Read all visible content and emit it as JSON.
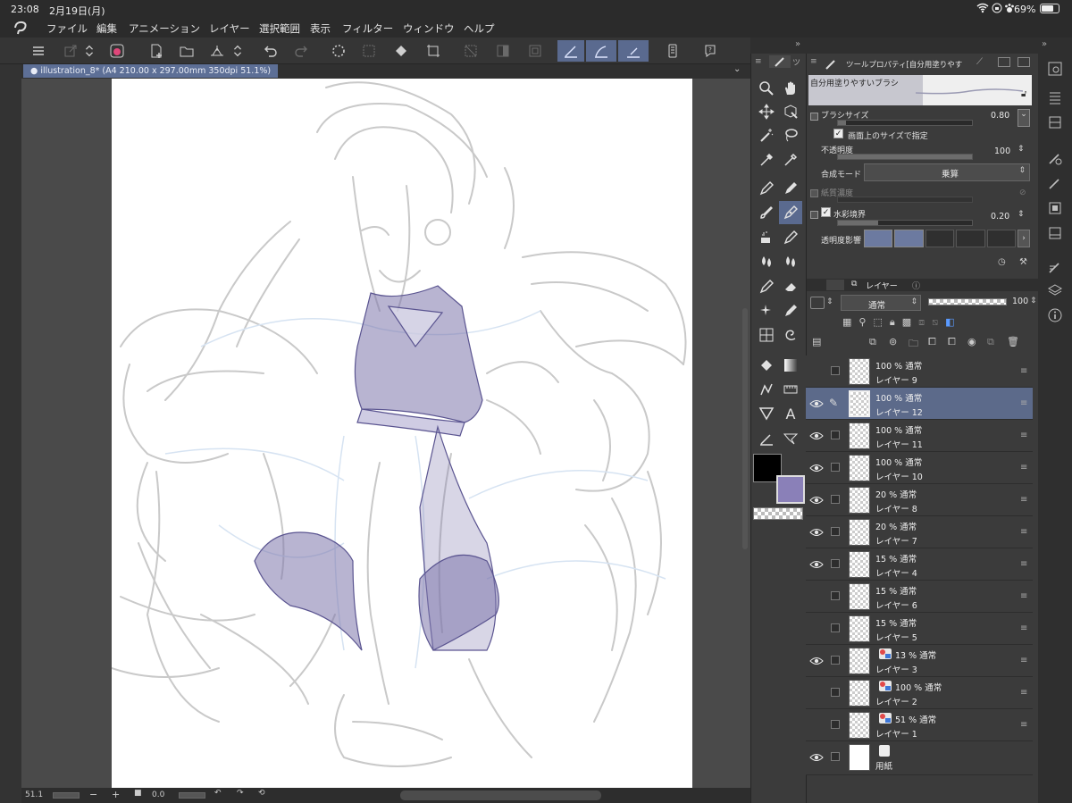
{
  "status": {
    "time": "23:08",
    "date": "2月19日(月)",
    "battery": "69%"
  },
  "menu": [
    "ファイル",
    "編集",
    "アニメーション",
    "レイヤー",
    "選択範囲",
    "表示",
    "フィルター",
    "ウィンドウ",
    "ヘルプ"
  ],
  "canvas": {
    "tab_label": "illustration_8* (A4 210.00 x 297.00mm 350dpi 51.1%)"
  },
  "bottom": {
    "zoom": "51.1",
    "angle": "0.0"
  },
  "tool_property": {
    "header": "ツールプロパティ[自分用塗りやす",
    "header_tab2": "ツ",
    "brush_name": "自分用塗りやすいブラシ",
    "brush_size_label": "ブラシサイズ",
    "brush_size_value": "0.80",
    "screen_size_label": "画面上のサイズで指定",
    "opacity_label": "不透明度",
    "opacity_value": "100",
    "blend_label": "合成モード",
    "blend_value": "乗算",
    "paper_label": "紙質濃度",
    "watercolor_label": "水彩境界",
    "watercolor_value": "0.20",
    "trans_label": "透明度影響"
  },
  "layer_panel": {
    "tab": "レイヤー",
    "blend_mode": "通常",
    "opacity": "100",
    "layers": [
      {
        "pct": "100 %  通常",
        "name": "レイヤー 9",
        "visible": false,
        "selected": false,
        "kind": "raster"
      },
      {
        "pct": "100 %  通常",
        "name": "レイヤー 12",
        "visible": true,
        "selected": true,
        "kind": "raster"
      },
      {
        "pct": "100 %  通常",
        "name": "レイヤー 11",
        "visible": true,
        "selected": false,
        "kind": "raster"
      },
      {
        "pct": "100 %  通常",
        "name": "レイヤー 10",
        "visible": true,
        "selected": false,
        "kind": "raster"
      },
      {
        "pct": "20 %  通常",
        "name": "レイヤー 8",
        "visible": true,
        "selected": false,
        "kind": "raster"
      },
      {
        "pct": "20 %  通常",
        "name": "レイヤー 7",
        "visible": true,
        "selected": false,
        "kind": "raster"
      },
      {
        "pct": "15 %  通常",
        "name": "レイヤー 4",
        "visible": true,
        "selected": false,
        "kind": "raster"
      },
      {
        "pct": "15 %  通常",
        "name": "レイヤー 6",
        "visible": false,
        "selected": false,
        "kind": "raster"
      },
      {
        "pct": "15 %  通常",
        "name": "レイヤー 5",
        "visible": false,
        "selected": false,
        "kind": "raster"
      },
      {
        "pct": "13 %  通常",
        "name": "レイヤー 3",
        "visible": true,
        "selected": false,
        "kind": "vector"
      },
      {
        "pct": "100 %  通常",
        "name": "レイヤー 2",
        "visible": false,
        "selected": false,
        "kind": "vector"
      },
      {
        "pct": "51 %  通常",
        "name": "レイヤー 1",
        "visible": false,
        "selected": false,
        "kind": "vector"
      },
      {
        "pct": "",
        "name": "用紙",
        "visible": true,
        "selected": false,
        "kind": "paper"
      }
    ]
  },
  "colors": {
    "main": "#000000",
    "sub": "#8a80b8",
    "selected_row": "#5c6a8a",
    "accent": "#5a6a8f"
  }
}
